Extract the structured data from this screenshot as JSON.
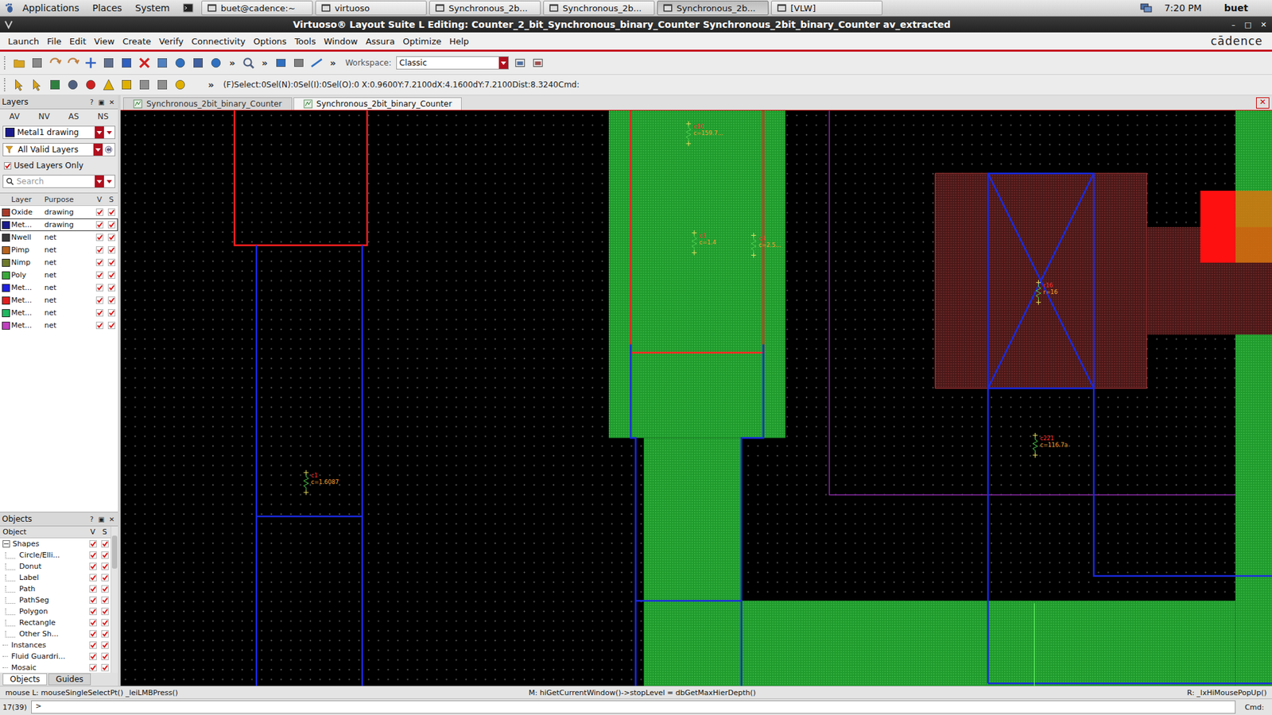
{
  "top_panel": {
    "menus": [
      "Applications",
      "Places",
      "System"
    ],
    "tasks": [
      {
        "label": "buet@cadence:~",
        "selected": false
      },
      {
        "label": "virtuoso",
        "selected": false
      },
      {
        "label": "Synchronous_2b...",
        "selected": false
      },
      {
        "label": "Synchronous_2b...",
        "selected": false
      },
      {
        "label": "Synchronous_2b...",
        "selected": true
      },
      {
        "label": "[VLW]",
        "selected": false
      }
    ],
    "clock": "7:20 PM",
    "user": "buet"
  },
  "window": {
    "title": "Virtuoso® Layout Suite L Editing: Counter_2_bit_Synchronous_binary_Counter Synchronous_2bit_binary_Counter av_extracted",
    "controls": [
      "–",
      "□",
      "✕"
    ]
  },
  "menu_bar": {
    "items": [
      "Launch",
      "File",
      "Edit",
      "View",
      "Create",
      "Verify",
      "Connectivity",
      "Options",
      "Tools",
      "Window",
      "Assura",
      "Optimize",
      "Help"
    ],
    "logo": "cādence"
  },
  "toolbar": {
    "overflow": "»",
    "workspace_label": "Workspace:",
    "workspace": "Classic"
  },
  "status_line": "(F)Select:0Sel(N):0Sel(I):0Sel(O):0  X:0.9600Y:7.2100dX:4.1600dY:7.2100Dist:8.3240Cmd:",
  "panel_controls": [
    "?",
    "▣",
    "✕"
  ],
  "layers_panel": {
    "title": "Layers",
    "tabs": [
      {
        "label": "AV",
        "selected": false
      },
      {
        "label": "NV",
        "selected": false
      },
      {
        "label": "AS",
        "selected": false
      },
      {
        "label": "NS",
        "selected": false
      }
    ],
    "layer_select": "Metal1 drawing",
    "layer_select_color": "#1a1a8c",
    "filter": "All Valid Layers",
    "used_only": {
      "label": "Used Layers Only",
      "checked": true
    },
    "search_placeholder": "Search",
    "columns": [
      "Layer",
      "Purpose",
      "V",
      "S"
    ],
    "rows": [
      {
        "layer": "Oxide",
        "purpose": "drawing",
        "color": "#a83a2a",
        "visible": true,
        "selectable": true,
        "selected": false
      },
      {
        "layer": "Met...",
        "purpose": "drawing",
        "color": "#1a1a8c",
        "visible": true,
        "selectable": true,
        "selected": true
      },
      {
        "layer": "Nwell",
        "purpose": "net",
        "color": "#3a3a3a",
        "visible": true,
        "selectable": true,
        "selected": false
      },
      {
        "layer": "Pimp",
        "purpose": "net",
        "color": "#b8641e",
        "visible": true,
        "selectable": true,
        "selected": false
      },
      {
        "layer": "Nimp",
        "purpose": "net",
        "color": "#6e7a2a",
        "visible": true,
        "selectable": true,
        "selected": false
      },
      {
        "layer": "Poly",
        "purpose": "net",
        "color": "#3aa83a",
        "visible": true,
        "selectable": true,
        "selected": false
      },
      {
        "layer": "Met...",
        "purpose": "net",
        "color": "#2020e0",
        "visible": true,
        "selectable": true,
        "selected": false
      },
      {
        "layer": "Met...",
        "purpose": "net",
        "color": "#e02020",
        "visible": true,
        "selectable": true,
        "selected": false
      },
      {
        "layer": "Met...",
        "purpose": "net",
        "color": "#20b860",
        "visible": true,
        "selectable": true,
        "selected": false
      },
      {
        "layer": "Met...",
        "purpose": "net",
        "color": "#c040c0",
        "visible": true,
        "selectable": true,
        "selected": false
      }
    ]
  },
  "objects_panel": {
    "title": "Objects",
    "columns": [
      "Object",
      "V",
      "S"
    ],
    "rows": [
      {
        "label": "Shapes",
        "kind": "group",
        "expanded": true,
        "visible": true,
        "selectable": true
      },
      {
        "label": "Circle/Elli...",
        "kind": "child",
        "expanded": false,
        "visible": true,
        "selectable": true
      },
      {
        "label": "Donut",
        "kind": "child",
        "expanded": false,
        "visible": true,
        "selectable": true
      },
      {
        "label": "Label",
        "kind": "child",
        "expanded": false,
        "visible": true,
        "selectable": true
      },
      {
        "label": "Path",
        "kind": "child",
        "expanded": false,
        "visible": true,
        "selectable": true
      },
      {
        "label": "PathSeg",
        "kind": "child",
        "expanded": false,
        "visible": true,
        "selectable": true
      },
      {
        "label": "Polygon",
        "kind": "child",
        "expanded": false,
        "visible": true,
        "selectable": true
      },
      {
        "label": "Rectangle",
        "kind": "child",
        "expanded": false,
        "visible": true,
        "selectable": true
      },
      {
        "label": "Other Sh...",
        "kind": "child",
        "expanded": false,
        "visible": true,
        "selectable": true
      },
      {
        "label": "Instances",
        "kind": "item",
        "expanded": false,
        "visible": true,
        "selectable": true
      },
      {
        "label": "Fluid Guardri...",
        "kind": "item",
        "expanded": false,
        "visible": true,
        "selectable": true
      },
      {
        "label": "Mosaic",
        "kind": "item",
        "expanded": false,
        "visible": true,
        "selectable": true
      }
    ],
    "tabs": [
      {
        "label": "Objects",
        "selected": true
      },
      {
        "label": "Guides",
        "selected": false
      }
    ]
  },
  "canvas": {
    "tabs": [
      {
        "label": "Synchronous_2bit_binary_Counter",
        "selected": false
      },
      {
        "label": "Synchronous_2bit_binary_Counter",
        "selected": true
      }
    ],
    "close": "✕",
    "annotations": [
      {
        "name": "c1",
        "value": "c=1.6087"
      },
      {
        "name": "c10",
        "value": "c=159.7..."
      },
      {
        "name": "c3",
        "value": "c=1.4"
      },
      {
        "name": "c4",
        "value": "c=2.5..."
      },
      {
        "name": "r16",
        "value": "r=16"
      },
      {
        "name": "c221",
        "value": "c=116.7a"
      }
    ]
  },
  "status_bar": {
    "left": "mouse L: mouseSingleSelectPt() _leiLMBPress()",
    "middle": "M: hiGetCurrentWindow()->stopLevel = dbGetMaxHierDepth()",
    "right": "R: _lxHiMousePopUp()"
  },
  "command_line": {
    "count": "17(39)",
    "prompt": ">",
    "label": "Cmd:"
  }
}
